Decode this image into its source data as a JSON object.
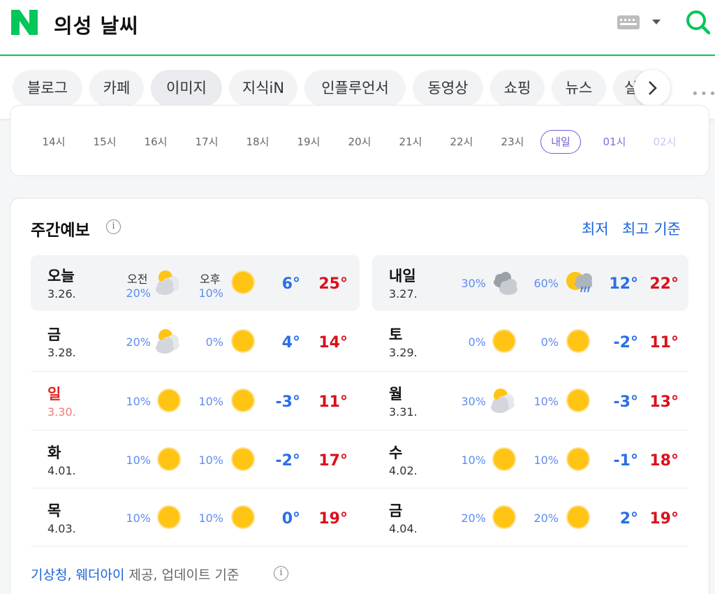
{
  "header": {
    "logo": "N",
    "query": "의성 날씨",
    "keyboard_icon": "keyboard-icon",
    "search_icon": "search-icon"
  },
  "colors": {
    "brand": "#03c75a",
    "low": "#2b6fe5",
    "high": "#d9111c",
    "link": "#1b64da",
    "tomorrow": "#6b5fd7"
  },
  "tabs": [
    "블로그",
    "카페",
    "이미지",
    "지식iN",
    "인플루언서",
    "동영상",
    "쇼핑",
    "뉴스",
    "실"
  ],
  "hourly": [
    "14시",
    "15시",
    "16시",
    "17시",
    "18시",
    "19시",
    "20시",
    "21시",
    "22시",
    "23시",
    "내일",
    "01시",
    "02시"
  ],
  "weekly": {
    "title": "주간예보",
    "basis_low": "최저",
    "basis_high": "최고 기준",
    "ampm": {
      "am": "오전",
      "pm": "오후"
    },
    "days": [
      {
        "day": "오늘",
        "date": "3.26.",
        "am_pct": "20%",
        "am_icon": "partly-cloudy-icon",
        "pm_pct": "10%",
        "pm_icon": "sunny-icon",
        "low": "6°",
        "high": "25°"
      },
      {
        "day": "내일",
        "date": "3.27.",
        "am_pct": "30%",
        "am_icon": "cloudy-icon",
        "pm_pct": "60%",
        "pm_icon": "sun-rain-icon",
        "low": "12°",
        "high": "22°"
      },
      {
        "day": "금",
        "date": "3.28.",
        "am_pct": "20%",
        "am_icon": "partly-cloudy-icon",
        "pm_pct": "0%",
        "pm_icon": "sunny-icon",
        "low": "4°",
        "high": "14°"
      },
      {
        "day": "토",
        "date": "3.29.",
        "am_pct": "0%",
        "am_icon": "sunny-icon",
        "pm_pct": "0%",
        "pm_icon": "sunny-icon",
        "low": "-2°",
        "high": "11°"
      },
      {
        "day": "일",
        "date": "3.30.",
        "am_pct": "10%",
        "am_icon": "sunny-icon",
        "pm_pct": "10%",
        "pm_icon": "sunny-icon",
        "low": "-3°",
        "high": "11°"
      },
      {
        "day": "월",
        "date": "3.31.",
        "am_pct": "30%",
        "am_icon": "partly-cloudy-icon",
        "pm_pct": "10%",
        "pm_icon": "sunny-icon",
        "low": "-3°",
        "high": "13°"
      },
      {
        "day": "화",
        "date": "4.01.",
        "am_pct": "10%",
        "am_icon": "sunny-icon",
        "pm_pct": "10%",
        "pm_icon": "sunny-icon",
        "low": "-2°",
        "high": "17°"
      },
      {
        "day": "수",
        "date": "4.02.",
        "am_pct": "10%",
        "am_icon": "sunny-icon",
        "pm_pct": "10%",
        "pm_icon": "sunny-icon",
        "low": "-1°",
        "high": "18°"
      },
      {
        "day": "목",
        "date": "4.03.",
        "am_pct": "10%",
        "am_icon": "sunny-icon",
        "pm_pct": "10%",
        "pm_icon": "sunny-icon",
        "low": "0°",
        "high": "19°"
      },
      {
        "day": "금",
        "date": "4.04.",
        "am_pct": "20%",
        "am_icon": "sunny-icon",
        "pm_pct": "20%",
        "pm_icon": "sunny-icon",
        "low": "2°",
        "high": "19°"
      }
    ]
  },
  "footer": {
    "sources": "기상청, 웨더아이",
    "suffix": " 제공, 업데이트 기준"
  }
}
